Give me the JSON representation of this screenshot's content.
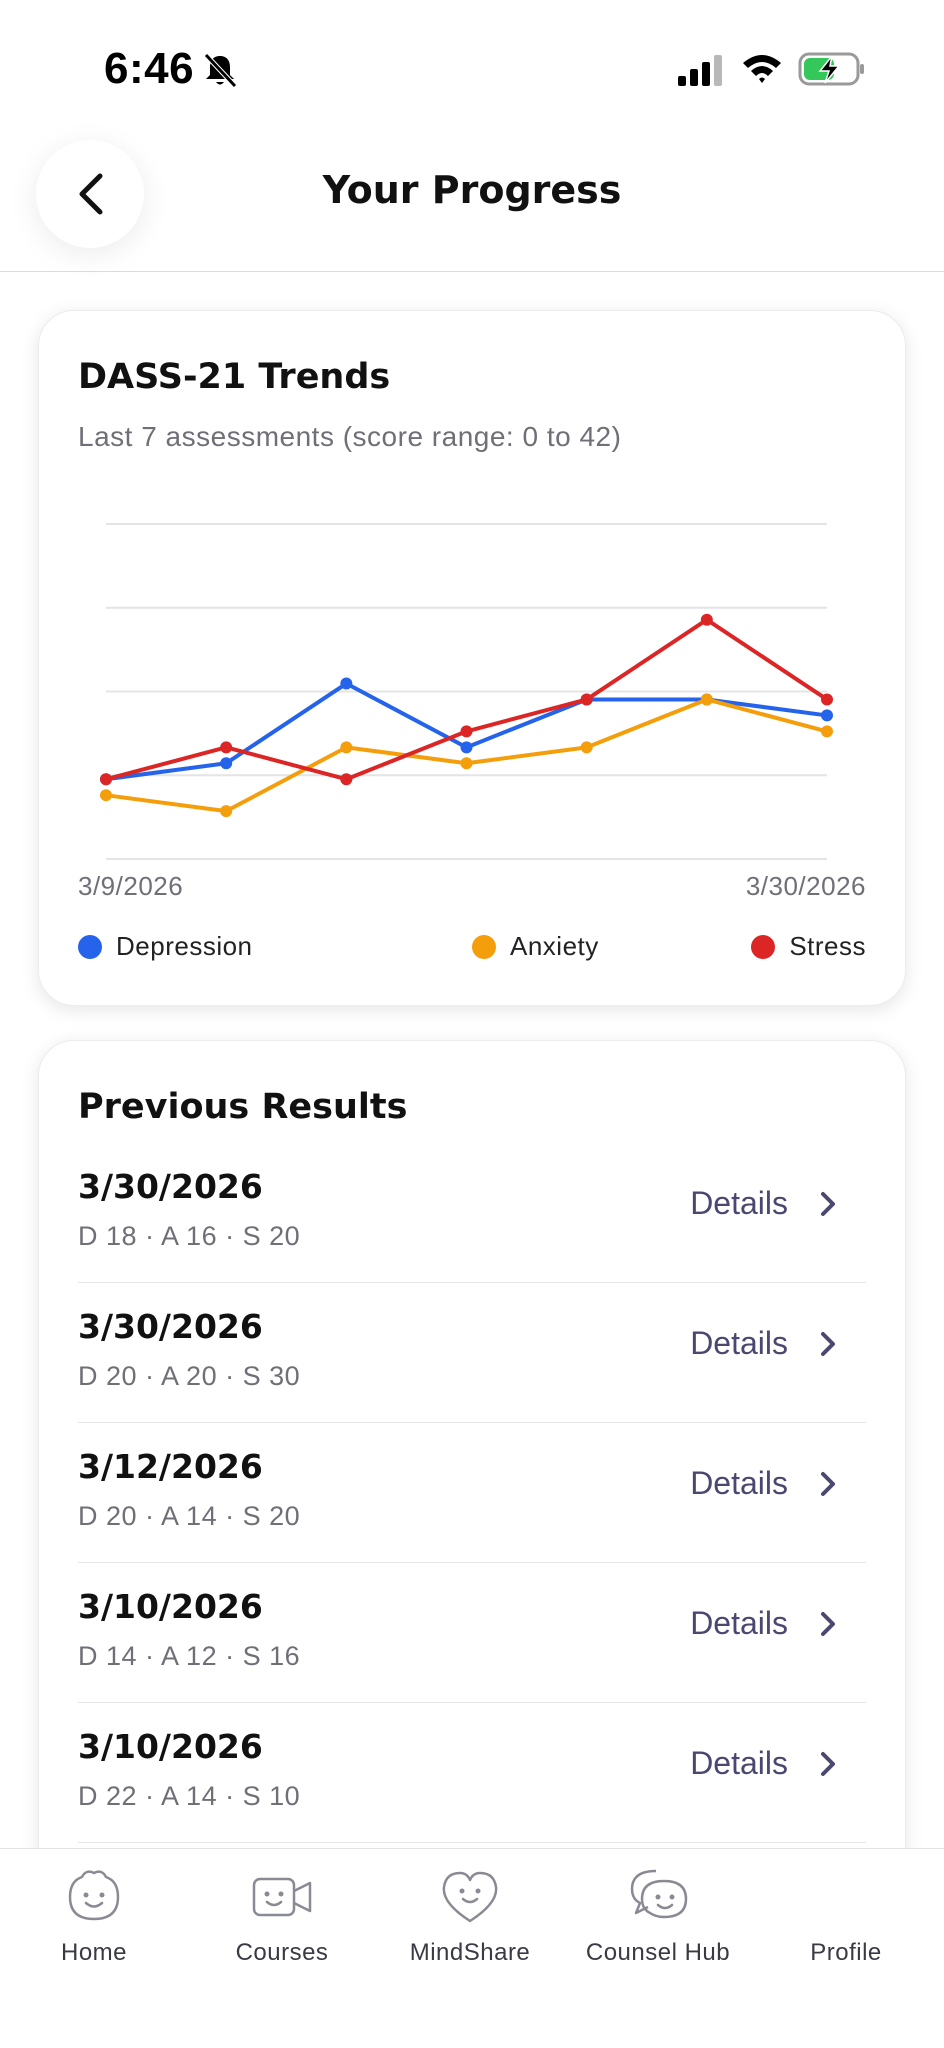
{
  "status_bar": {
    "time": "6:46"
  },
  "header": {
    "title": "Your Progress",
    "back_icon": "chevron-left-icon"
  },
  "trends_card": {
    "title": "DASS-21 Trends",
    "subtitle": "Last 7 assessments (score range: 0 to 42)",
    "x_start_label": "3/9/2026",
    "x_end_label": "3/30/2026",
    "legend": [
      {
        "label": "Depression",
        "color": "#2563eb"
      },
      {
        "label": "Anxiety",
        "color": "#f59e0b"
      },
      {
        "label": "Stress",
        "color": "#dc2626"
      }
    ]
  },
  "chart_data": {
    "type": "line",
    "ylim": [
      0,
      42
    ],
    "grid": true,
    "series": [
      {
        "name": "Depression",
        "color": "#2563eb",
        "values": [
          10,
          12,
          22,
          14,
          20,
          20,
          18
        ]
      },
      {
        "name": "Anxiety",
        "color": "#f59e0b",
        "values": [
          8,
          6,
          14,
          12,
          14,
          20,
          16
        ]
      },
      {
        "name": "Stress",
        "color": "#dc2626",
        "values": [
          10,
          14,
          10,
          16,
          20,
          30,
          20
        ]
      }
    ]
  },
  "results": {
    "title": "Previous Results",
    "details_label": "Details",
    "items": [
      {
        "date": "3/30/2026",
        "scores": "D 18 · A 16 · S 20"
      },
      {
        "date": "3/30/2026",
        "scores": "D 20 · A 20 · S 30"
      },
      {
        "date": "3/12/2026",
        "scores": "D 20 · A 14 · S 20"
      },
      {
        "date": "3/10/2026",
        "scores": "D 14 · A 12 · S 16"
      },
      {
        "date": "3/10/2026",
        "scores": "D 22 · A 14 · S 10"
      }
    ]
  },
  "tab_bar": {
    "tabs": [
      {
        "label": "Home",
        "icon": "home-face-icon"
      },
      {
        "label": "Courses",
        "icon": "video-camera-face-icon"
      },
      {
        "label": "MindShare",
        "icon": "heart-face-icon"
      },
      {
        "label": "Counsel Hub",
        "icon": "chat-bubbles-face-icon"
      },
      {
        "label": "Profile",
        "icon": "profile-icon"
      }
    ]
  }
}
